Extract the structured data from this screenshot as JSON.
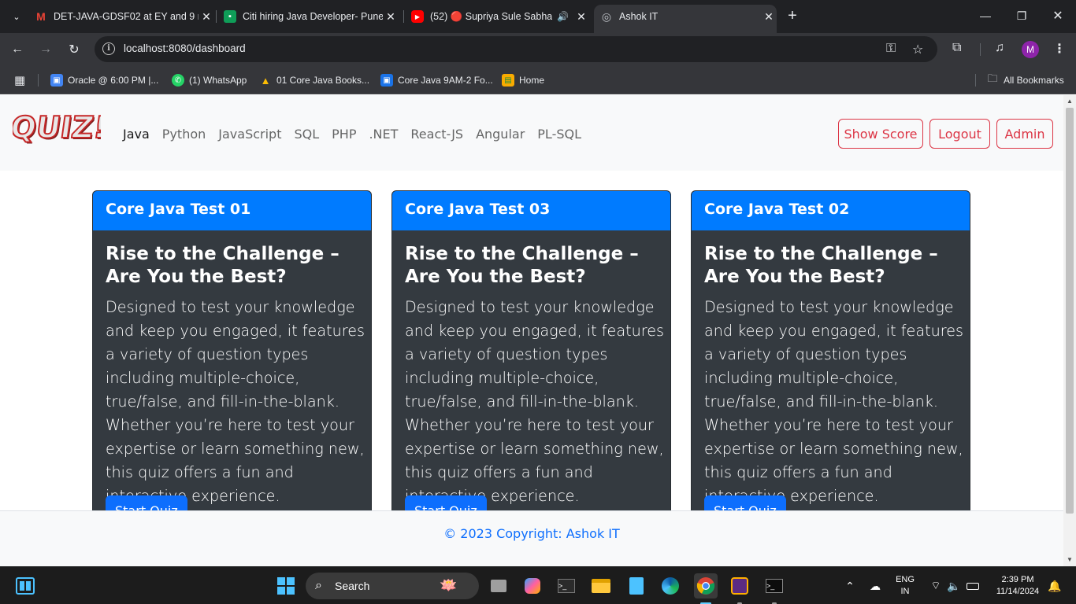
{
  "browser": {
    "tabs": [
      {
        "title": "DET-JAVA-GDSF02 at EY and 9 n",
        "icon": "gmail-icon"
      },
      {
        "title": "Citi hiring Java Developer- Pune",
        "icon": "sheet-icon"
      },
      {
        "title": "(52) 🔴 Supriya Sule Sabha",
        "icon": "youtube-icon"
      },
      {
        "title": "Ashok IT",
        "icon": "globe-icon"
      }
    ],
    "url_host": "localhost",
    "url_path": ":8080/dashboard",
    "profile_initial": "M",
    "bookmarks": [
      {
        "label": "Oracle @ 6:00 PM |...",
        "icon": "meet-icon"
      },
      {
        "label": "(1) WhatsApp",
        "icon": "whatsapp-icon"
      },
      {
        "label": "01 Core Java Books...",
        "icon": "drive-icon"
      },
      {
        "label": "Core Java 9AM-2 Fo...",
        "icon": "classroom-icon"
      },
      {
        "label": "Home",
        "icon": "image-icon"
      }
    ],
    "all_bookmarks": "All Bookmarks"
  },
  "page": {
    "logo_text": "QUIZ!",
    "nav_links": [
      "Java",
      "Python",
      "JavaScript",
      "SQL",
      "PHP",
      ".NET",
      "React-JS",
      "Angular",
      "PL-SQL"
    ],
    "buttons": {
      "show_score": "Show Score",
      "logout": "Logout",
      "admin": "Admin"
    },
    "cards": [
      {
        "header": "Core Java Test 01",
        "title": "Rise to the Challenge – Are You the Best?",
        "text": "Designed to test your knowledge and keep you engaged, it features a variety of question types including multiple-choice, true/false, and fill-in-the-blank. Whether you’re here to test your expertise or learn something new, this quiz offers a fun and interactive experience.",
        "button": "Start Quiz"
      },
      {
        "header": "Core Java Test 03",
        "title": "Rise to the Challenge – Are You the Best?",
        "text": "Designed to test your knowledge and keep you engaged, it features a variety of question types including multiple-choice, true/false, and fill-in-the-blank. Whether you’re here to test your expertise or learn something new, this quiz offers a fun and interactive experience.",
        "button": "Start Quiz"
      },
      {
        "header": "Core Java Test 02",
        "title": "Rise to the Challenge – Are You the Best?",
        "text": "Designed to test your knowledge and keep you engaged, it features a variety of question types including multiple-choice, true/false, and fill-in-the-blank. Whether you’re here to test your expertise or learn something new, this quiz offers a fun and interactive experience.",
        "button": "Start Quiz"
      }
    ],
    "footer": "© 2023 Copyright: Ashok IT"
  },
  "taskbar": {
    "search_placeholder": "Search",
    "lang_top": "ENG",
    "lang_bottom": "IN",
    "time": "2:39 PM",
    "date": "11/14/2024"
  },
  "colors": {
    "primary": "#0d6efd",
    "card_body": "#343a40",
    "danger": "#dc3545",
    "navbar_bg": "#f8f9fa",
    "chrome_dark": "#202124"
  }
}
